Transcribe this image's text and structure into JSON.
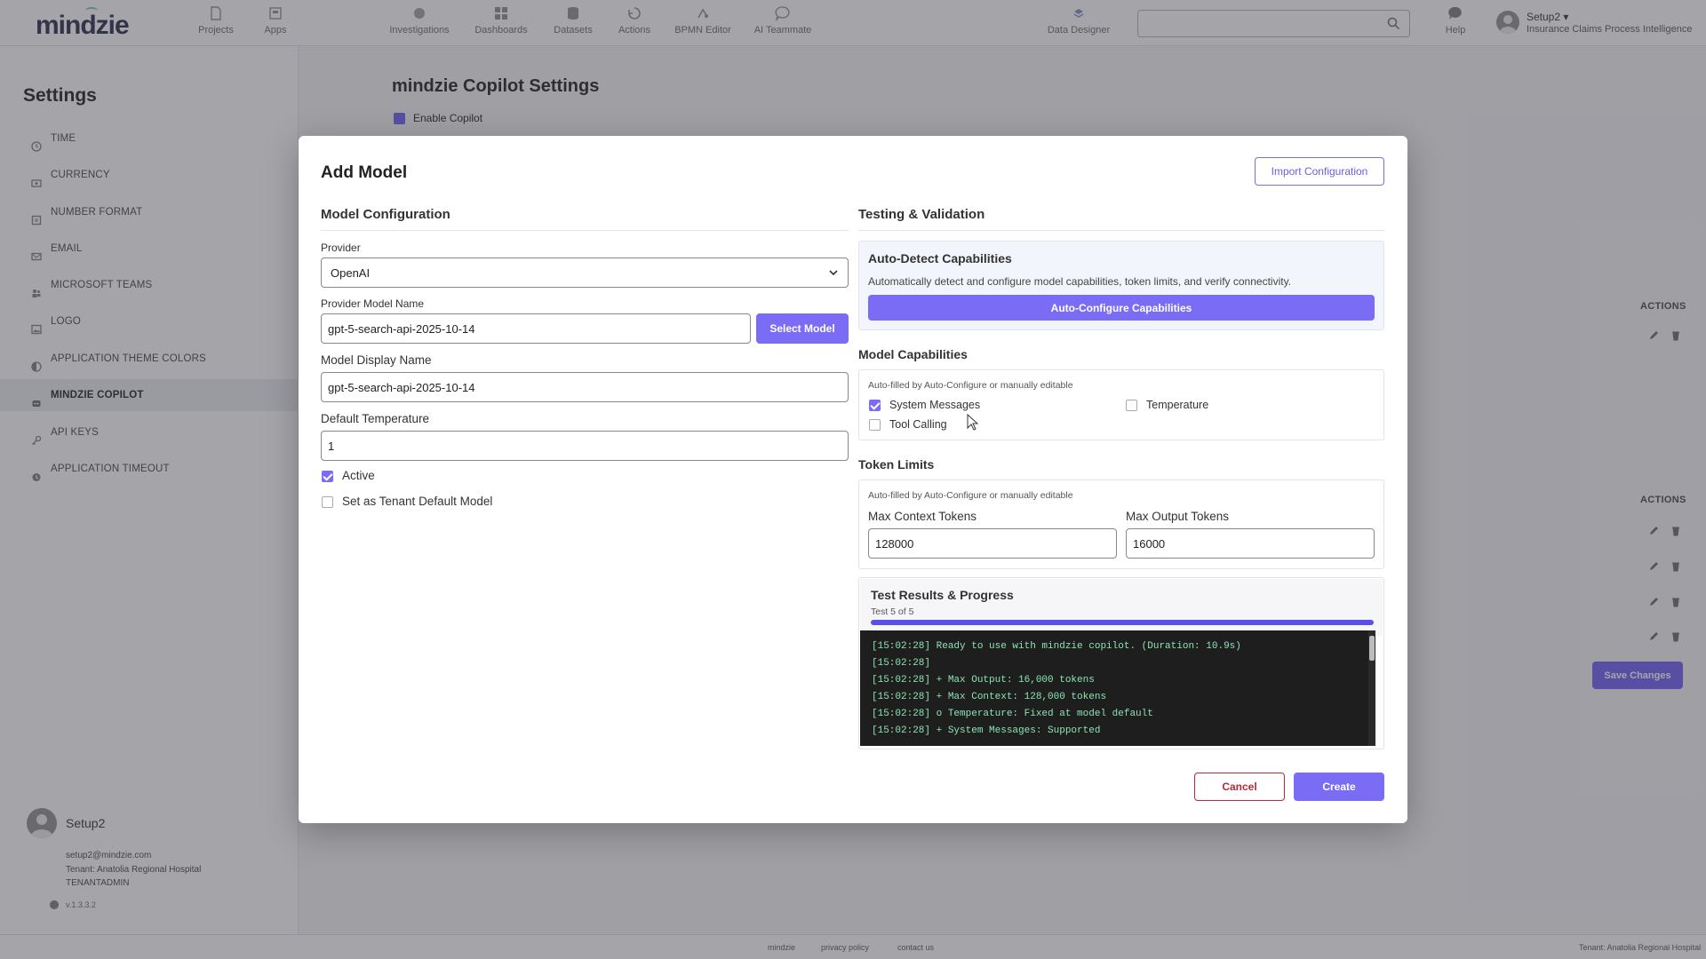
{
  "nav": {
    "logo": "mindzie",
    "items": [
      {
        "label": "Projects",
        "icon": "document-icon"
      },
      {
        "label": "Apps",
        "icon": "apps-icon"
      },
      {
        "label": "Investigations",
        "icon": "investigations-icon"
      },
      {
        "label": "Dashboards",
        "icon": "dashboard-icon"
      },
      {
        "label": "Datasets",
        "icon": "database-icon"
      },
      {
        "label": "Actions",
        "icon": "actions-icon"
      },
      {
        "label": "BPMN Editor",
        "icon": "bpmn-icon"
      },
      {
        "label": "AI Teammate",
        "icon": "chat-icon"
      },
      {
        "label": "Data Designer",
        "icon": "data-designer-icon"
      }
    ],
    "search_placeholder": "",
    "help_label": "Help",
    "user_name": "Setup2",
    "user_project": "Insurance Claims Process Intelligence"
  },
  "sidebar": {
    "title": "Settings",
    "items": [
      {
        "label": "TIME",
        "icon": "clock-icon"
      },
      {
        "label": "CURRENCY",
        "icon": "currency-icon"
      },
      {
        "label": "NUMBER FORMAT",
        "icon": "number-icon"
      },
      {
        "label": "EMAIL",
        "icon": "email-icon"
      },
      {
        "label": "MICROSOFT TEAMS",
        "icon": "teams-icon"
      },
      {
        "label": "LOGO",
        "icon": "image-icon"
      },
      {
        "label": "APPLICATION THEME COLORS",
        "icon": "palette-icon"
      },
      {
        "label": "MINDZIE COPILOT",
        "icon": "copilot-icon"
      },
      {
        "label": "API KEYS",
        "icon": "key-icon"
      },
      {
        "label": "APPLICATION TIMEOUT",
        "icon": "timeout-icon"
      }
    ],
    "active_index": 7,
    "user": {
      "name": "Setup2",
      "email": "setup2@mindzie.com",
      "tenant": "Tenant: Anatolia Regional Hospital",
      "role": "TENANTADMIN",
      "version": "v.1.3.3.2"
    }
  },
  "main": {
    "title": "mindzie Copilot Settings",
    "enable_label": "Enable Copilot",
    "actions_header": "ACTIONS",
    "save_label": "Save Changes"
  },
  "footer": {
    "links": [
      "mindzie",
      "privacy policy",
      "contact us"
    ],
    "tenant": "Tenant: Anatolia Regional Hospital"
  },
  "modal": {
    "title": "Add Model",
    "import_label": "Import Configuration",
    "config": {
      "title": "Model Configuration",
      "provider_label": "Provider",
      "provider_value": "OpenAI",
      "model_name_label": "Provider Model Name",
      "model_name_value": "gpt-5-search-api-2025-10-14",
      "select_model_label": "Select Model",
      "display_name_label": "Model Display Name",
      "display_name_value": "gpt-5-search-api-2025-10-14",
      "temperature_label": "Default Temperature",
      "temperature_value": "1",
      "active_label": "Active",
      "active_checked": true,
      "default_label": "Set as Tenant Default Model",
      "default_checked": false
    },
    "testing": {
      "title": "Testing & Validation",
      "auto_title": "Auto-Detect Capabilities",
      "auto_text": "Automatically detect and configure model capabilities, token limits, and verify connectivity.",
      "auto_button": "Auto-Configure Capabilities",
      "capabilities_title": "Model Capabilities",
      "capabilities_hint": "Auto-filled by Auto-Configure or manually editable",
      "system_messages_label": "System Messages",
      "system_messages_checked": true,
      "temperature_cap_label": "Temperature",
      "temperature_cap_checked": false,
      "tool_calling_label": "Tool Calling",
      "tool_calling_checked": false,
      "tokens_title": "Token Limits",
      "tokens_hint": "Auto-filled by Auto-Configure or manually editable",
      "max_context_label": "Max Context Tokens",
      "max_context_value": "128000",
      "max_output_label": "Max Output Tokens",
      "max_output_value": "16000",
      "results_title": "Test Results & Progress",
      "progress_text": "Test 5 of 5",
      "progress_fraction": 1.0,
      "log": [
        "[15:02:28] Ready to use with mindzie copilot. (Duration: 10.9s)",
        "[15:02:28]",
        "[15:02:28] + Max Output: 16,000 tokens",
        "[15:02:28] + Max Context: 128,000 tokens",
        "[15:02:28] o Temperature: Fixed at model default",
        "[15:02:28] + System Messages: Supported"
      ]
    },
    "cancel_label": "Cancel",
    "create_label": "Create"
  },
  "colors": {
    "accent": "#7b6cf6",
    "danger": "#b52a3a",
    "log_bg": "#1e1e1e",
    "log_text": "#8ce4b4"
  }
}
